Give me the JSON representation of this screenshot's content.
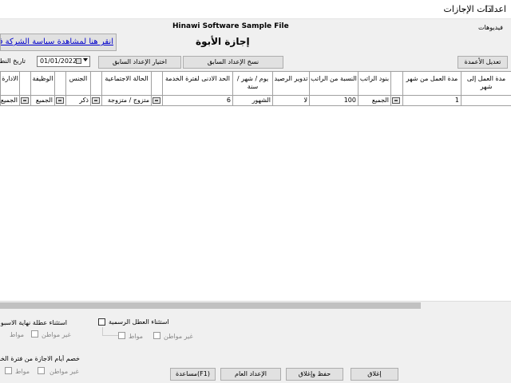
{
  "window": {
    "title": "اعدادات الإجازات",
    "minimize": "–",
    "maximize": "☐"
  },
  "header": {
    "company": "Hinawi Software Sample File",
    "page_title": "إجازة الأبوة",
    "sidebar_label": "فيديوهات",
    "link_text": "انقر هنا لمشاهدة سياسة الشركة في"
  },
  "toolbar": {
    "edit_columns": "تعديل الأعمدة",
    "copy_previous": "نسخ الإعداد السابق",
    "choose_previous": "اختيار الإعداد السابق",
    "date_value": "01/01/2022",
    "date_label": "تاريخ النط"
  },
  "table": {
    "headers": {
      "from_month": "مدة العمل إلى شهر",
      "to_month": "مدة العمل من شهر",
      "salary_items": "بنود الراتب",
      "percent": "النسبة من الراتب",
      "rollover": "تدوير الرصيد",
      "unit": "يوم / شهر / سنة",
      "min_service": "الحد الادنى لفترة الخدمة",
      "marital": "الحالة الاجتماعية",
      "gender": "الجنس",
      "job": "الوظيفة",
      "dept": "الادارة"
    },
    "row": {
      "from_month": "",
      "to_month": "1",
      "salary_items": "الجميع",
      "percent": "100",
      "rollover": "لا",
      "unit": "الشهور",
      "min_service": "6",
      "marital": "متزوج / متزوجة",
      "gender": "ذكر",
      "job": "الجميع",
      "dept": "الجميع"
    }
  },
  "options": {
    "holidays_label": "استثناء العطل الرسمية",
    "weekend_label": "استثناء عطلة نهاية الاسبو",
    "deduct_label": "خصم أيام الاجازة من فترة الخدم",
    "citizen": "مواط",
    "noncitizen": "غير مواطن"
  },
  "footer": {
    "close": "إغلاق",
    "save_close": "حفظ وإغلاق",
    "general_settings": "الإعداد العام",
    "help": "(F1)مساعدة"
  }
}
